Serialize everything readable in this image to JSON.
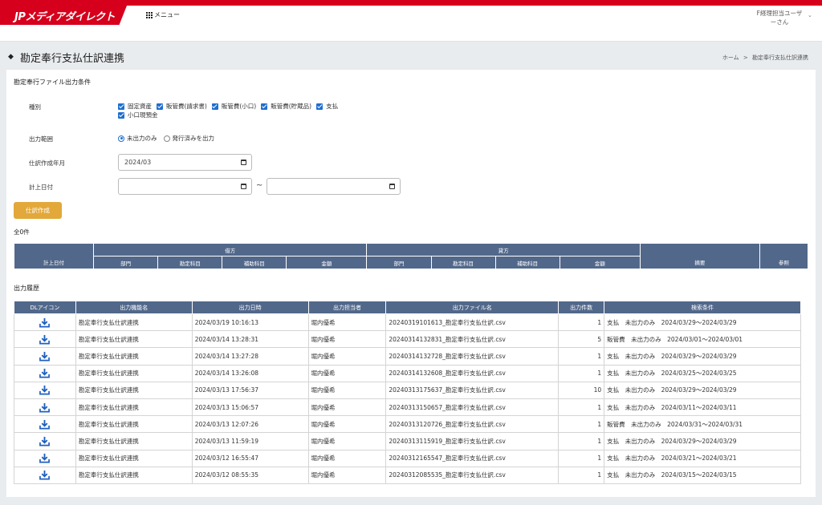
{
  "app": {
    "logo_text": "JPメディアダイレクト",
    "menu_label": "メニュー",
    "user_line1": "F経理担当ユーザ",
    "user_line2": "ーさん"
  },
  "page": {
    "title": "勘定奉行支払仕訳連携",
    "breadcrumb_home": "ホーム",
    "breadcrumb_sep": ">",
    "breadcrumb_current": "勘定奉行支払仕訳連携"
  },
  "conditions": {
    "section_title": "勘定奉行ファイル出力条件",
    "type_label": "種別",
    "types": [
      {
        "label": "固定資産",
        "checked": true
      },
      {
        "label": "販管費(請求書)",
        "checked": true
      },
      {
        "label": "販管費(小口)",
        "checked": true
      },
      {
        "label": "販管費(貯蔵品)",
        "checked": true
      },
      {
        "label": "支払",
        "checked": true
      },
      {
        "label": "小口現預金",
        "checked": true
      }
    ],
    "range_label": "出力範囲",
    "range_options": [
      {
        "label": "未出力のみ",
        "selected": true
      },
      {
        "label": "発行済みを出力",
        "selected": false
      }
    ],
    "month_label": "仕訳作成年月",
    "month_value": "2024/03",
    "date_label": "計上日付",
    "date_from": "",
    "date_to": "",
    "tilde": "~",
    "create_button": "仕訳作成"
  },
  "journal": {
    "count_text": "全0件",
    "col_date": "計上日付",
    "debit": "借方",
    "credit": "貸方",
    "sub_cols": [
      "部門",
      "勘定科目",
      "補助科目",
      "金額"
    ],
    "col_summary": "摘要",
    "col_ref": "参照"
  },
  "history": {
    "section_title": "出力履歴",
    "columns": [
      "DLアイコン",
      "出力機能名",
      "出力日時",
      "出力担当者",
      "出力ファイル名",
      "出力件数",
      "検索条件"
    ],
    "rows": [
      {
        "func": "勘定奉行支払仕訳連携",
        "datetime": "2024/03/19 10:16:13",
        "user": "堀内優希",
        "file": "20240319101613_勘定奉行支払仕訳.csv",
        "count": "1",
        "cond": "支払　未出力のみ　2024/03/29～2024/03/29"
      },
      {
        "func": "勘定奉行支払仕訳連携",
        "datetime": "2024/03/14 13:28:31",
        "user": "堀内優希",
        "file": "20240314132831_勘定奉行支払仕訳.csv",
        "count": "5",
        "cond": "販管費　未出力のみ　2024/03/01～2024/03/01"
      },
      {
        "func": "勘定奉行支払仕訳連携",
        "datetime": "2024/03/14 13:27:28",
        "user": "堀内優希",
        "file": "20240314132728_勘定奉行支払仕訳.csv",
        "count": "1",
        "cond": "支払　未出力のみ　2024/03/29～2024/03/29"
      },
      {
        "func": "勘定奉行支払仕訳連携",
        "datetime": "2024/03/14 13:26:08",
        "user": "堀内優希",
        "file": "20240314132608_勘定奉行支払仕訳.csv",
        "count": "1",
        "cond": "支払　未出力のみ　2024/03/25～2024/03/25"
      },
      {
        "func": "勘定奉行支払仕訳連携",
        "datetime": "2024/03/13 17:56:37",
        "user": "堀内優希",
        "file": "20240313175637_勘定奉行支払仕訳.csv",
        "count": "10",
        "cond": "支払　未出力のみ　2024/03/29～2024/03/29"
      },
      {
        "func": "勘定奉行支払仕訳連携",
        "datetime": "2024/03/13 15:06:57",
        "user": "堀内優希",
        "file": "20240313150657_勘定奉行支払仕訳.csv",
        "count": "1",
        "cond": "支払　未出力のみ　2024/03/11～2024/03/11"
      },
      {
        "func": "勘定奉行支払仕訳連携",
        "datetime": "2024/03/13 12:07:26",
        "user": "堀内優希",
        "file": "20240313120726_勘定奉行支払仕訳.csv",
        "count": "1",
        "cond": "販管費　未出力のみ　2024/03/31～2024/03/31"
      },
      {
        "func": "勘定奉行支払仕訳連携",
        "datetime": "2024/03/13 11:59:19",
        "user": "堀内優希",
        "file": "20240313115919_勘定奉行支払仕訳.csv",
        "count": "1",
        "cond": "支払　未出力のみ　2024/03/29～2024/03/29"
      },
      {
        "func": "勘定奉行支払仕訳連携",
        "datetime": "2024/03/12 16:55:47",
        "user": "堀内優希",
        "file": "20240312165547_勘定奉行支払仕訳.csv",
        "count": "1",
        "cond": "支払　未出力のみ　2024/03/21～2024/03/21"
      },
      {
        "func": "勘定奉行支払仕訳連携",
        "datetime": "2024/03/12 08:55:35",
        "user": "堀内優希",
        "file": "20240312085535_勘定奉行支払仕訳.csv",
        "count": "1",
        "cond": "支払　未出力のみ　2024/03/15～2024/03/15"
      }
    ]
  },
  "colors": {
    "brand_red": "#d6001c",
    "table_header": "#52688b",
    "button_gold": "#e2a83a",
    "checkbox_blue": "#1f6fcf",
    "download_icon": "#1f5fbf"
  },
  "icons": {
    "menu": "grid-icon",
    "download": "download-icon",
    "calendar": "calendar-icon"
  }
}
